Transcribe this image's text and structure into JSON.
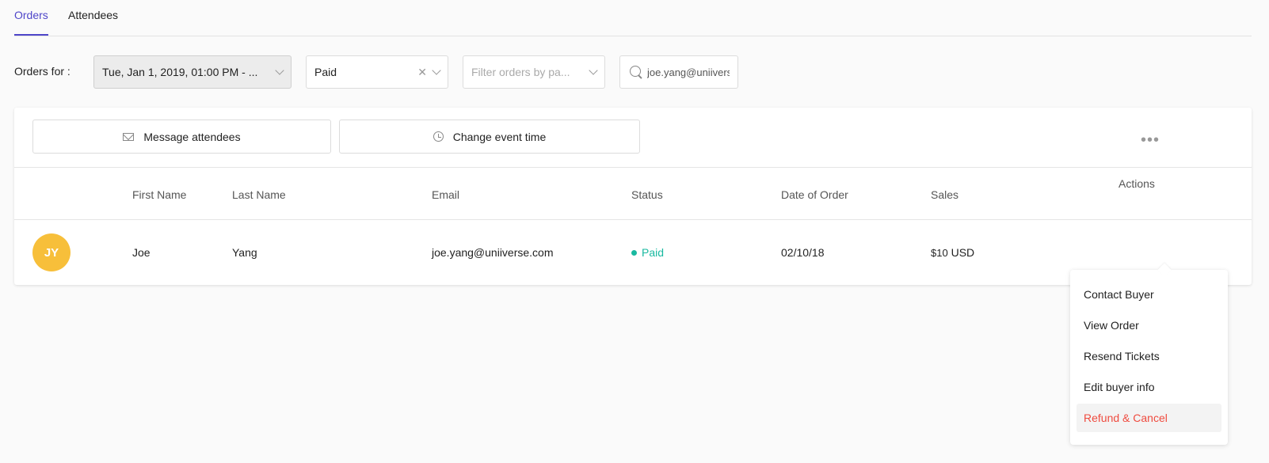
{
  "tabs": [
    {
      "label": "Orders",
      "active": true
    },
    {
      "label": "Attendees",
      "active": false
    }
  ],
  "filters": {
    "label": "Orders for :",
    "date_value": "Tue, Jan 1, 2019, 01:00 PM - ...",
    "status_value": "Paid",
    "type_placeholder": "Filter orders by pa...",
    "search_value": "joe.yang@uniiverse.com"
  },
  "actions": {
    "message": "Message attendees",
    "change_time": "Change event time"
  },
  "table": {
    "headers": {
      "first_name": "First Name",
      "last_name": "Last Name",
      "email": "Email",
      "status": "Status",
      "date": "Date of Order",
      "sales": "Sales",
      "actions": "Actions"
    },
    "rows": [
      {
        "initials": "JY",
        "first_name": "Joe",
        "last_name": "Yang",
        "email": "joe.yang@uniiverse.com",
        "status": "Paid",
        "date": "02/10/18",
        "sales_amount": "$10",
        "sales_currency": "USD"
      }
    ]
  },
  "row_menu": [
    {
      "label": "Contact Buyer"
    },
    {
      "label": "View Order"
    },
    {
      "label": "Resend Tickets"
    },
    {
      "label": "Edit buyer info"
    },
    {
      "label": "Refund & Cancel"
    }
  ],
  "colors": {
    "accent": "#4f46c9",
    "paid": "#19b9a0",
    "avatar": "#f7bf3a",
    "danger": "#ef4b3f"
  },
  "icons": {
    "search": "search-icon",
    "mail": "mail-icon",
    "clock": "alarm-clock-icon",
    "more": "more-horizontal-icon",
    "chevron": "chevron-down-icon",
    "clear": "close-icon"
  }
}
